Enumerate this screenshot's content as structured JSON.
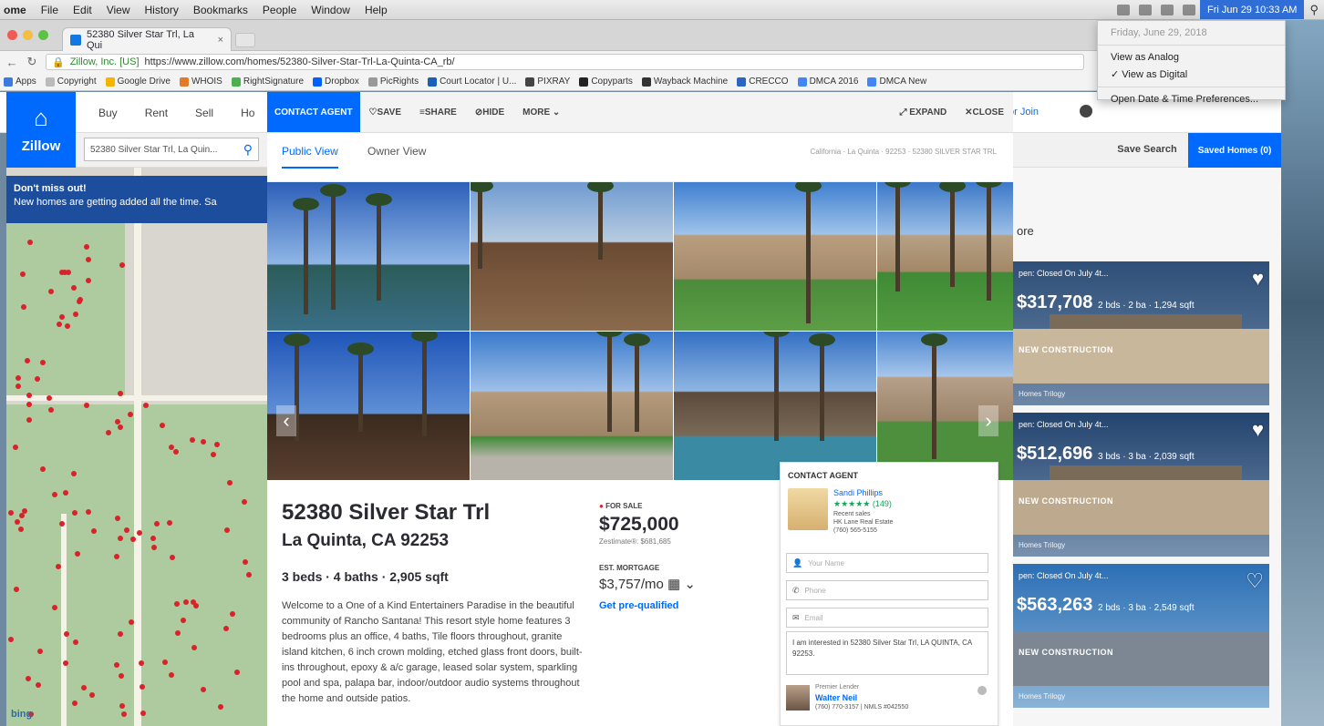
{
  "menubar": {
    "app": "ome",
    "items": [
      "File",
      "Edit",
      "View",
      "History",
      "Bookmarks",
      "People",
      "Window",
      "Help"
    ],
    "clock": "Fri Jun 29  10:33 AM"
  },
  "clock_menu": {
    "date": "Friday, June 29, 2018",
    "analog": "View as Analog",
    "digital": "✓ View as Digital",
    "prefs": "Open Date & Time Preferences..."
  },
  "browser": {
    "tab_title": "52380 Silver Star Trl, La Qui",
    "tab_close": "×",
    "lock": "🔒",
    "org": "Zillow, Inc. [US]",
    "url": "https://www.zillow.com/homes/52380-Silver-Star-Trl-La-Quinta-CA_rb/",
    "bookmarks": [
      "Apps",
      "Copyright",
      "Google Drive",
      "WHOIS",
      "RightSignature",
      "Dropbox",
      "PicRights",
      "Court Locator | U...",
      "PIXRAY",
      "Copyparts",
      "Wayback Machine",
      "CRECCO",
      "DMCA 2016",
      "DMCA New"
    ]
  },
  "zillow": {
    "logo_text": "Zillow",
    "nav": [
      "Buy",
      "Rent",
      "Sell",
      "Ho"
    ],
    "search_value": "52380 Silver Star Trl, La Quin...",
    "sign_in": "or Join",
    "save_search": "Save Search",
    "saved_homes": "Saved Homes (0)"
  },
  "toast": {
    "title": "Don't miss out!",
    "text": "New homes are getting added all the time. Sa"
  },
  "map": {
    "attribution": "bing"
  },
  "modal": {
    "contact_agent_tab": "CONTACT AGENT",
    "save": "♡SAVE",
    "share": "≡SHARE",
    "hide": "⊘HIDE",
    "more": "MORE ⌄",
    "expand": "⤢ EXPAND",
    "close": "✕CLOSE",
    "public_view": "Public View",
    "owner_view": "Owner View",
    "breadcrumb": "California · La Quinta · 92253 · 52380 SILVER STAR TRL"
  },
  "listing": {
    "address_line1": "52380 Silver Star Trl",
    "address_line2": "La Quinta, CA 92253",
    "specs": "3 beds · 4 baths · 2,905 sqft",
    "status": "FOR SALE",
    "price": "$725,000",
    "zestimate": "Zestimate®: $681,685",
    "mortgage_label": "EST. MORTGAGE",
    "mortgage": "$3,757/mo ▦ ⌄",
    "prequal": "Get pre-qualified",
    "description": "Welcome to a One of a Kind Entertainers Paradise in the beautiful community of Rancho Santana! This resort style home features 3 bedrooms plus an office, 4 baths, Tile floors throughout, granite island kitchen, 6 inch crown molding, etched glass front doors, built-ins throughout, epoxy & a/c garage, leased solar system, sparkling pool and spa, palapa bar, indoor/outdoor audio systems throughout the home and outside patios."
  },
  "contact": {
    "heading": "CONTACT AGENT",
    "agent_name": "Sandi Phillips",
    "stars": "★★★★★ (149)",
    "meta1": "Recent sales",
    "meta2": "HK Lane Real Estate",
    "meta3": "(760) 565-5155",
    "name_ph": "Your Name",
    "phone_ph": "Phone",
    "email_ph": "Email",
    "message": "I am interested in 52380 Silver Star Trl, LA QUINTA, CA 92253.",
    "lender_label": "Premier Lender",
    "lender_name": "Walter Neil",
    "lender_phone": "(760) 770-3157 | NMLS #042550"
  },
  "right_listings": {
    "more_label": "ore",
    "cards": [
      {
        "open": "pen: Closed On July 4t...",
        "tag": "NEW CONSTRUCTION",
        "price": "$317,708",
        "specs": "2 bds · 2 ba · 1,294 sqft",
        "addr": "Homes Trilogy"
      },
      {
        "open": "pen: Closed On July 4t...",
        "tag": "NEW CONSTRUCTION",
        "price": "$512,696",
        "specs": "3 bds · 3 ba · 2,039 sqft",
        "addr": "Homes Trilogy"
      },
      {
        "open": "pen: Closed On July 4t...",
        "tag": "NEW CONSTRUCTION",
        "price": "$563,263",
        "specs": "2 bds · 3 ba · 2,549 sqft",
        "addr": "Homes Trilogy"
      }
    ]
  },
  "colors": {
    "zillow_blue": "#006aff",
    "pin_red": "#d8232a",
    "mac_clock_blue": "#2f6ed6"
  }
}
